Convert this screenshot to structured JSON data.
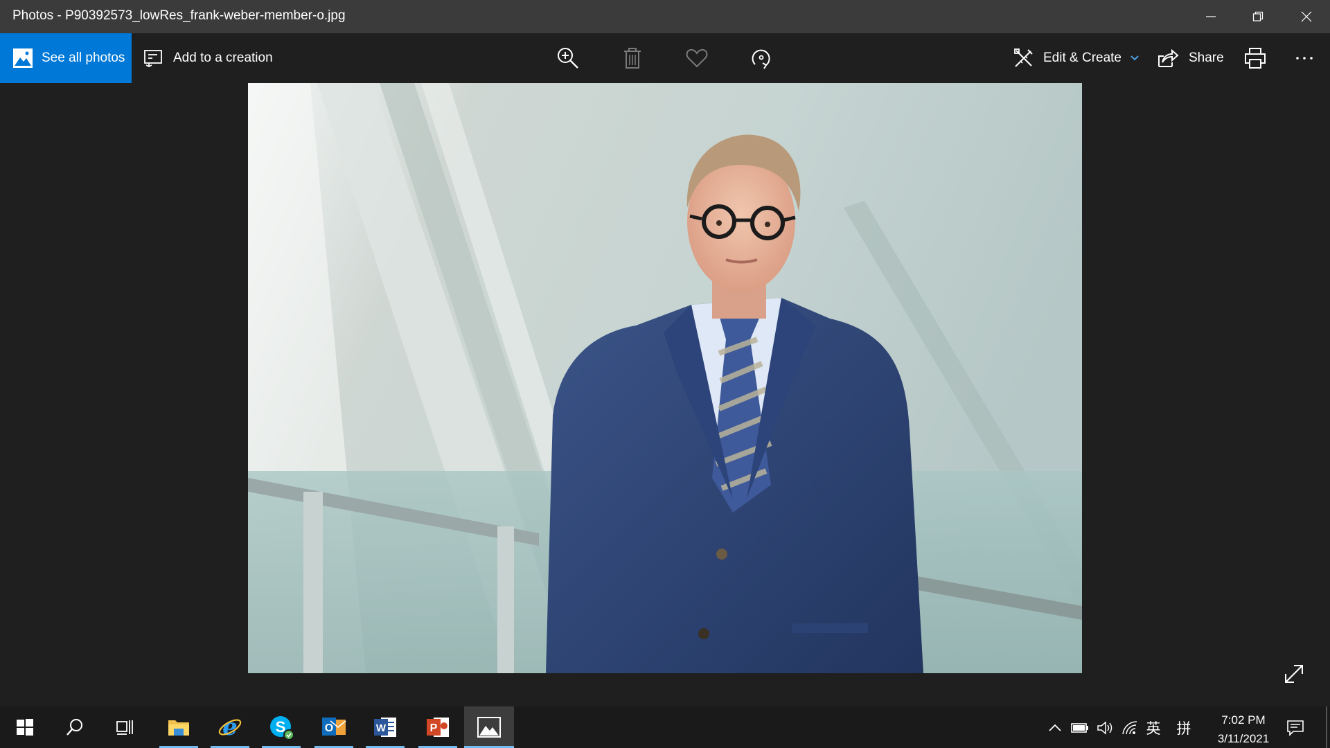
{
  "window": {
    "title": "Photos - P90392573_lowRes_frank-weber-member-o.jpg"
  },
  "toolbar": {
    "see_all_photos": "See all photos",
    "add_to_creation": "Add to a creation",
    "edit_create": "Edit & Create",
    "share": "Share",
    "icons": [
      "zoom-in-icon",
      "delete-icon",
      "heart-icon",
      "rotate-icon",
      "print-icon",
      "more-icon"
    ]
  },
  "taskbar": {
    "apps": [
      "start",
      "search",
      "task-view",
      "file-explorer",
      "internet-explorer",
      "skype",
      "outlook",
      "word",
      "powerpoint",
      "photos"
    ],
    "language": "英",
    "ime": "拼",
    "time": "7:02 PM",
    "date": "3/11/2021"
  },
  "colors": {
    "accent": "#0078d7",
    "titlebar": "#3b3b3b",
    "background": "#1f1f1f",
    "taskbar": "#1a1a1a"
  }
}
